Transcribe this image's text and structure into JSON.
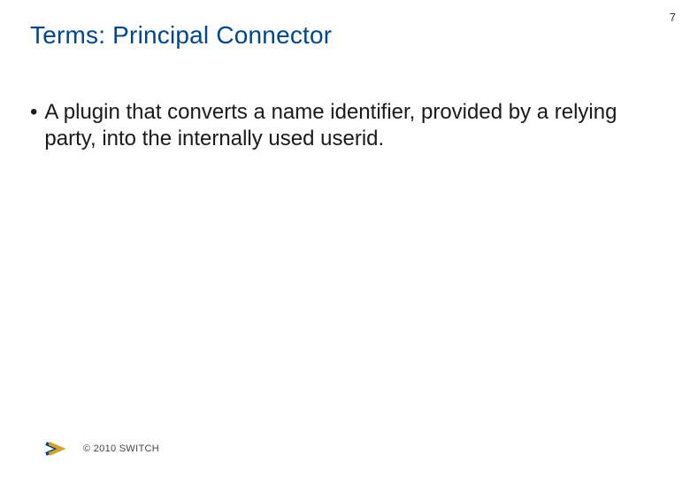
{
  "slide": {
    "title": "Terms: Principal Connector",
    "page_number": "7",
    "bullets": [
      {
        "text": "A plugin that converts a name identifier, provided by a relying party, into the internally used userid."
      }
    ],
    "footer": {
      "copyright": "© 2010 SWITCH"
    },
    "colors": {
      "title": "#00468b",
      "logo_blue": "#00468b",
      "logo_gold": "#d8a12a"
    }
  }
}
